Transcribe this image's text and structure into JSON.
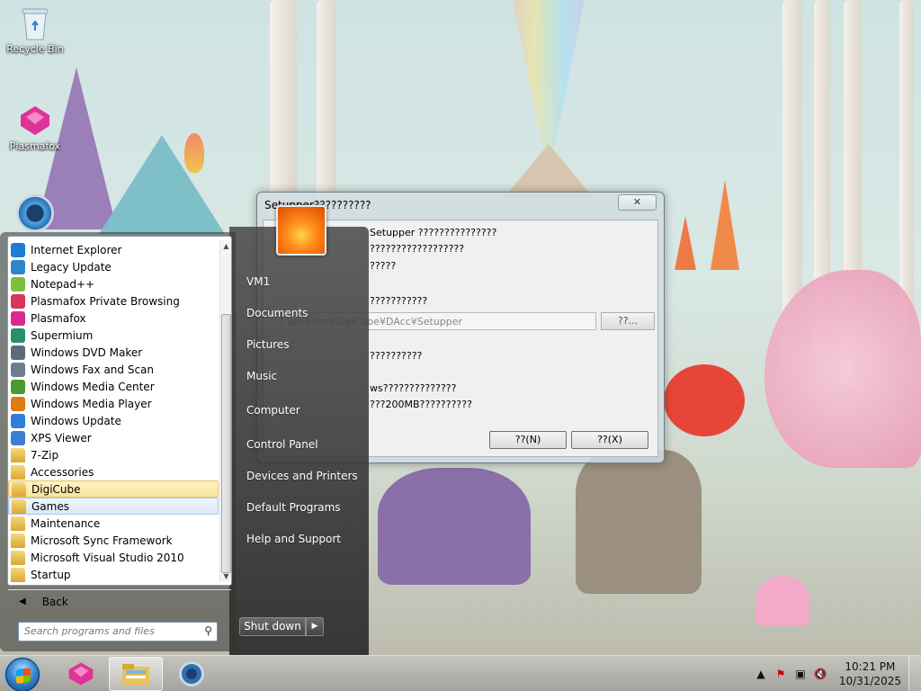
{
  "desktop": {
    "icons": [
      {
        "label": "Recycle Bin",
        "icon": "recycle-bin-icon"
      },
      {
        "label": "Plasmafox",
        "icon": "plasmafox-icon"
      }
    ]
  },
  "dialog": {
    "title": "Setupper??????????",
    "close_label": "✕",
    "lines": [
      "Setupper ???????????????",
      "??????????????????",
      "?????",
      "???????????",
      "??????????",
      "ws??????????????",
      "???200MB??????????"
    ],
    "path_value": "am Files¥DigiCube¥DAcc¥Setupper",
    "browse_label": "??...",
    "ok_label": "??(N)",
    "cancel_label": "??(X)"
  },
  "start_menu": {
    "programs": [
      {
        "label": "Internet Explorer",
        "icon": "internet-explorer-icon",
        "color": "#1e7bd6"
      },
      {
        "label": "Legacy Update",
        "icon": "legacy-update-icon",
        "color": "#2d86c9"
      },
      {
        "label": "Notepad++",
        "icon": "notepad-plus-plus-icon",
        "color": "#7bbf3a"
      },
      {
        "label": "Plasmafox Private Browsing",
        "icon": "plasmafox-private-icon",
        "color": "#d9345a"
      },
      {
        "label": "Plasmafox",
        "icon": "plasmafox-icon",
        "color": "#d92b8c"
      },
      {
        "label": "Supermium",
        "icon": "supermium-icon",
        "color": "#2a8f6a"
      },
      {
        "label": "Windows DVD Maker",
        "icon": "dvd-maker-icon",
        "color": "#5a6b7c"
      },
      {
        "label": "Windows Fax and Scan",
        "icon": "fax-scan-icon",
        "color": "#6d7f8f"
      },
      {
        "label": "Windows Media Center",
        "icon": "media-center-icon",
        "color": "#4a9a2e"
      },
      {
        "label": "Windows Media Player",
        "icon": "media-player-icon",
        "color": "#e07a12"
      },
      {
        "label": "Windows Update",
        "icon": "windows-update-icon",
        "color": "#2f7ed8"
      },
      {
        "label": "XPS Viewer",
        "icon": "xps-viewer-icon",
        "color": "#3a7fd0"
      },
      {
        "label": "7-Zip",
        "icon": "folder-icon",
        "folder": true
      },
      {
        "label": "Accessories",
        "icon": "folder-icon",
        "folder": true
      },
      {
        "label": "DigiCube",
        "icon": "folder-icon",
        "folder": true,
        "state": "highlighted"
      },
      {
        "label": "Games",
        "icon": "folder-icon",
        "folder": true,
        "state": "hover"
      },
      {
        "label": "Maintenance",
        "icon": "folder-icon",
        "folder": true
      },
      {
        "label": "Microsoft Sync Framework",
        "icon": "folder-icon",
        "folder": true
      },
      {
        "label": "Microsoft Visual Studio 2010",
        "icon": "folder-icon",
        "folder": true
      },
      {
        "label": "Startup",
        "icon": "folder-icon",
        "folder": true
      }
    ],
    "back_label": "Back",
    "search_placeholder": "Search programs and files",
    "right_items": [
      "VM1",
      "Documents",
      "Pictures",
      "Music",
      "Computer",
      "Control Panel",
      "Devices and Printers",
      "Default Programs",
      "Help and Support"
    ],
    "shutdown_label": "Shut down"
  },
  "taskbar": {
    "pinned": [
      "plasmafox-icon",
      "explorer-icon",
      "supermium-icon"
    ],
    "clock_time": "10:21 PM",
    "clock_date": "10/31/2025"
  }
}
